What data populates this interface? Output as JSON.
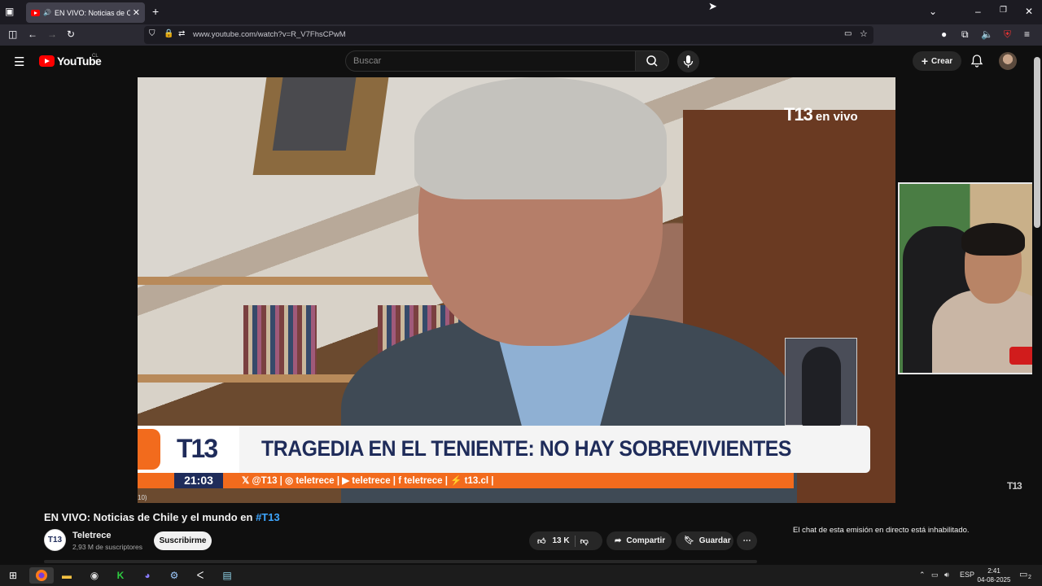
{
  "browser": {
    "tab_title": "EN VIVO: Noticias de Chile",
    "url": "www.youtube.com/watch?v=R_V7FhsCPwM"
  },
  "youtube": {
    "logo_text": "YouTube",
    "country_code": "CL",
    "search_placeholder": "Buscar",
    "create_label": "Crear"
  },
  "video": {
    "channel_bug": "T13",
    "live_label": "en vivo",
    "badge": "T13",
    "headline": "TRAGEDIA EN EL TENIENTE: NO HAY SOBREVIVIENTES",
    "ticker_time": "21:03",
    "ticker_handles": "𝕏 @T13   |   ◎ teletrece   |   ▶ teletrece   |   f teletrece   |   ⚡ t13.cl   |",
    "time_fragment": "10)",
    "corner_logo": "T13"
  },
  "info": {
    "title_main": "EN VIVO: Noticias de Chile y el mundo en ",
    "title_tag": "#T13",
    "channel_avatar": "T13",
    "channel_name": "Teletrece",
    "subscribers": "2,93 M de suscriptores",
    "subscribe_label": "Suscribirme",
    "likes": "13 K",
    "share_label": "Compartir",
    "save_label": "Guardar",
    "chat_message": "El chat de esta emisión en directo está inhabilitado."
  },
  "taskbar": {
    "language": "ESP",
    "time": "2:41",
    "date": "04-08-2025",
    "notifications": "2"
  }
}
